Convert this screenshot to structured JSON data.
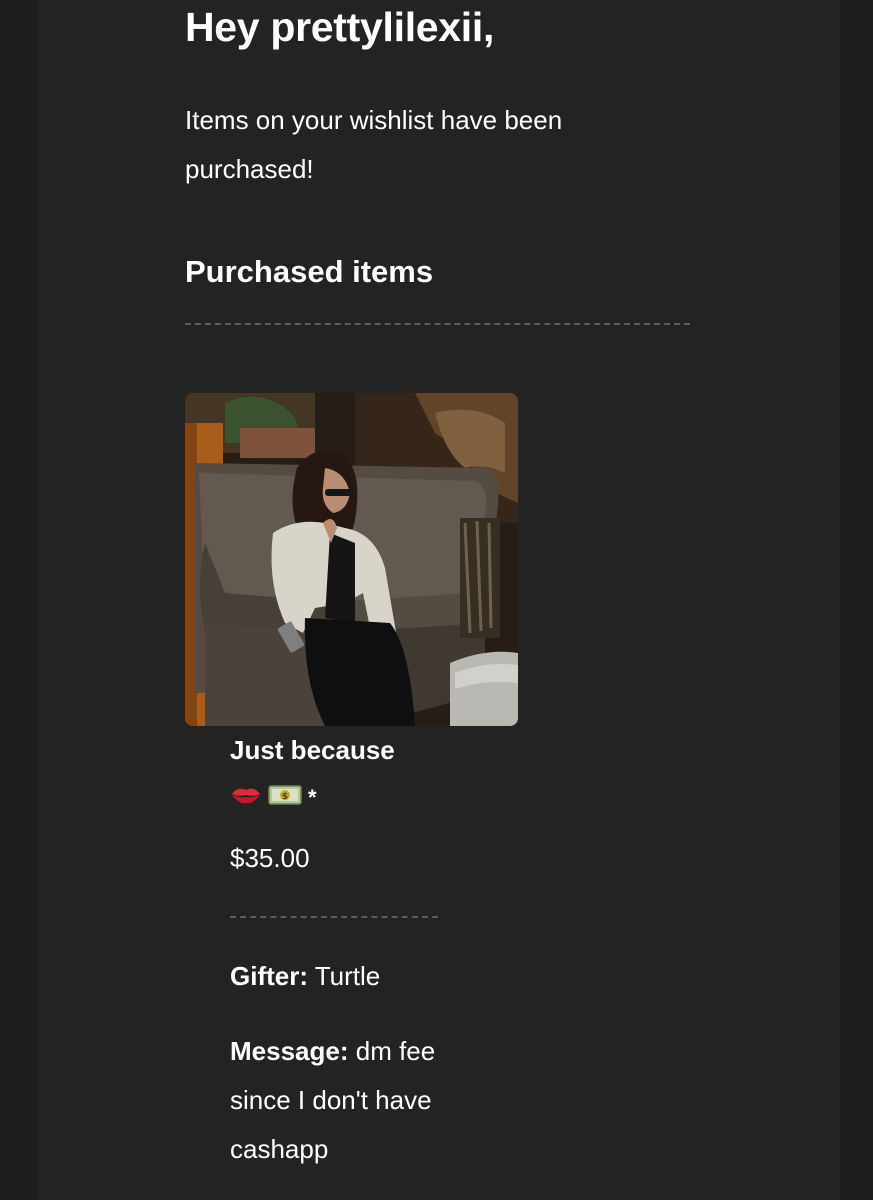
{
  "email": {
    "greeting": "Hey prettylilexii,",
    "intro": "Items on your wishlist have been purchased!",
    "section_heading": "Purchased items"
  },
  "item": {
    "title": "Just because",
    "emoji_icons": [
      "kiss-mark-icon",
      "money-bill-icon"
    ],
    "asterisk": "*",
    "price": "$35.00",
    "gifter_label": "Gifter:",
    "gifter_value": "Turtle",
    "message_label": "Message:",
    "message_value": "dm fee since I don't have cashapp"
  },
  "colors": {
    "background": "#1e1e1e",
    "card": "#242323",
    "text": "#ffffff",
    "divider": "#5e5d5d"
  }
}
